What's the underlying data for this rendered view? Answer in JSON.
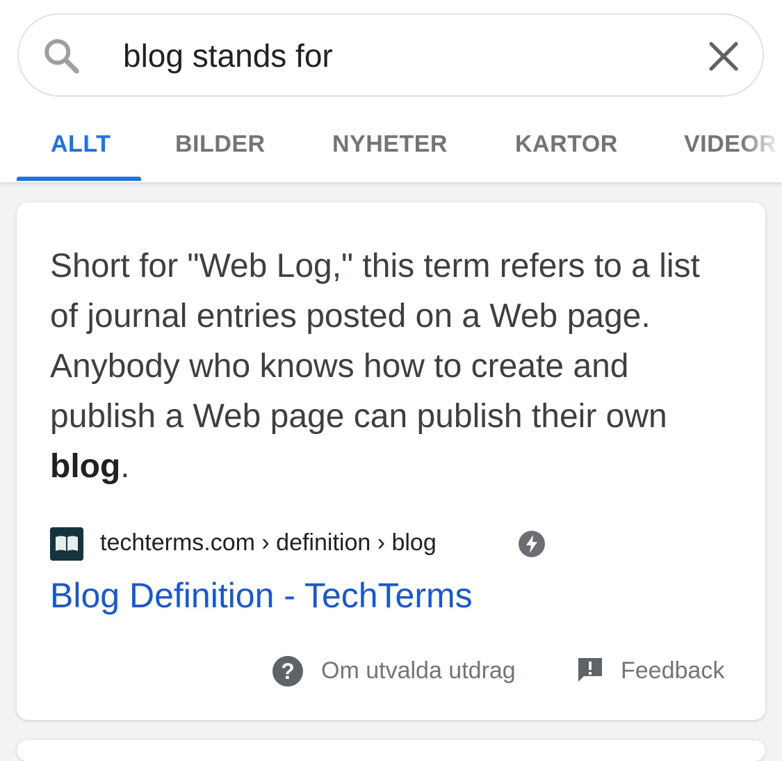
{
  "search": {
    "query": "blog stands for"
  },
  "tabs": [
    {
      "label": "ALLT"
    },
    {
      "label": "BILDER"
    },
    {
      "label": "NYHETER"
    },
    {
      "label": "KARTOR"
    },
    {
      "label": "VIDEOR"
    }
  ],
  "featured_snippet": {
    "text_before_bold": "Short for \"Web Log,\" this term refers to a list of journal entries posted on a Web page. Anybody who knows how to create and publish a Web page can publish their own ",
    "bold_term": "blog",
    "text_after_bold": ".",
    "source_breadcrumb": "techterms.com › definition › blog",
    "result_title": "Blog Definition - TechTerms",
    "about_label": "Om utvalda utdrag",
    "feedback_label": "Feedback"
  },
  "icons": {
    "search": "search-icon",
    "clear": "close-icon",
    "favicon": "book-icon",
    "amp": "lightning-icon",
    "about": "help-icon",
    "feedback": "feedback-icon"
  },
  "colors": {
    "accent": "#1a73e8",
    "link": "#1558d6",
    "muted": "#70757a"
  }
}
